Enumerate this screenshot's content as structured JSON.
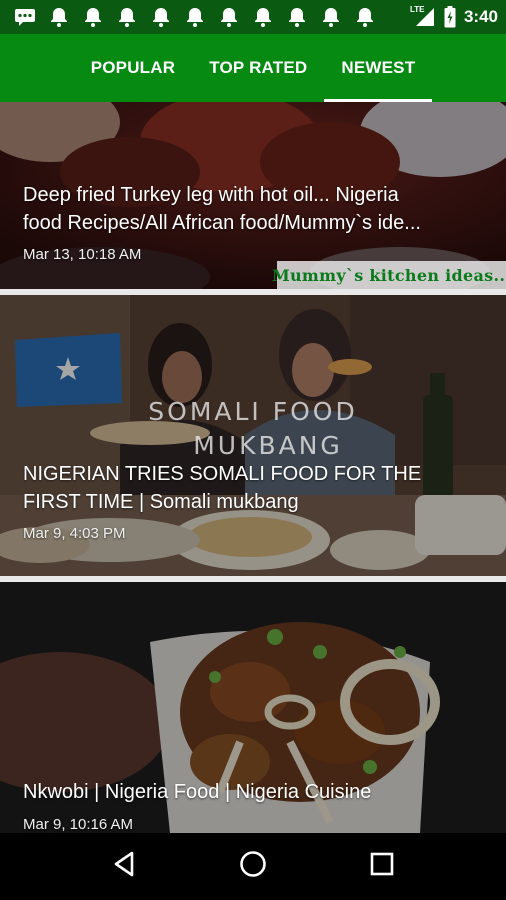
{
  "status_bar": {
    "notification_icons": [
      "message-icon",
      "bell-icon",
      "bell-icon",
      "bell-icon",
      "bell-icon",
      "bell-icon",
      "bell-icon",
      "bell-icon",
      "bell-icon",
      "bell-icon",
      "bell-icon"
    ],
    "network": "LTE",
    "time": "3:40"
  },
  "tabs": [
    {
      "label": "POPULAR",
      "selected": false
    },
    {
      "label": "TOP RATED",
      "selected": false
    },
    {
      "label": "NEWEST",
      "selected": true
    }
  ],
  "colors": {
    "status_bar": "#0b5a12",
    "tab_bar": "#078a12",
    "indicator": "#ffffff"
  },
  "videos": [
    {
      "title": "Deep fried Turkey leg with hot oil... Nigeria\nfood Recipes/All African food/Mummy`s ide...",
      "date": "Mar 13, 10:18 AM",
      "watermark": "Mummy`s kitchen ideas..."
    },
    {
      "title": "NIGERIAN TRIES SOMALI FOOD FOR THE\nFIRST TIME | Somali mukbang",
      "date": "Mar 9, 4:03 PM",
      "overlay_line1": "SOMALI FOOD",
      "overlay_line2": "MUKBANG"
    },
    {
      "title": "Nkwobi | Nigeria Food | Nigeria Cuisine",
      "date": "Mar 9, 10:16 AM"
    }
  ],
  "nav": [
    "back-icon",
    "home-icon",
    "recents-icon"
  ]
}
